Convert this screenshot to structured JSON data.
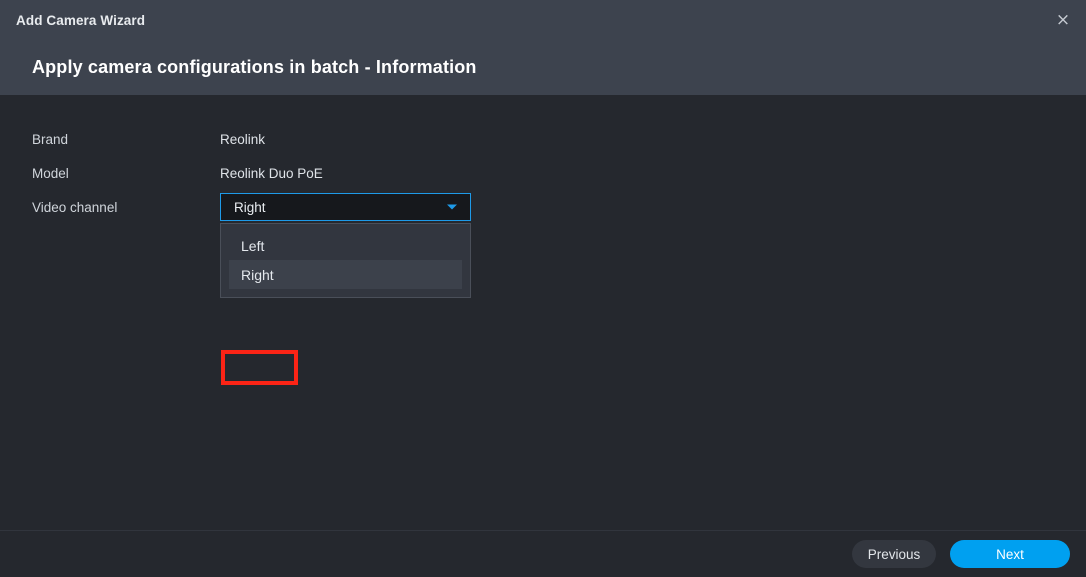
{
  "window": {
    "title": "Add Camera Wizard",
    "close_icon": "close-icon",
    "close_glyph": "×"
  },
  "header": {
    "heading": "Apply camera configurations in batch - Information"
  },
  "form": {
    "rows": [
      {
        "label": "Brand",
        "value": "Reolink"
      },
      {
        "label": "Model",
        "value": "Reolink Duo PoE"
      }
    ],
    "video_channel": {
      "label": "Video channel",
      "selected": "Right",
      "expanded": true,
      "options": [
        {
          "label": "Left",
          "highlighted": false
        },
        {
          "label": "Right",
          "highlighted": true
        }
      ],
      "arrow_icon": "chevron-down-icon"
    }
  },
  "footer": {
    "previous_label": "Previous",
    "next_label": "Next"
  },
  "colors": {
    "titlebar": "#3d434e",
    "header": "#3d434e",
    "body": "#25282e",
    "accent": "#00a0f0",
    "combo_border": "#1e9ae8",
    "dropdown_bg": "#32363f",
    "highlight_row": "#3c414b",
    "annotation": "#fb2416",
    "previous_button": "#33373f"
  }
}
